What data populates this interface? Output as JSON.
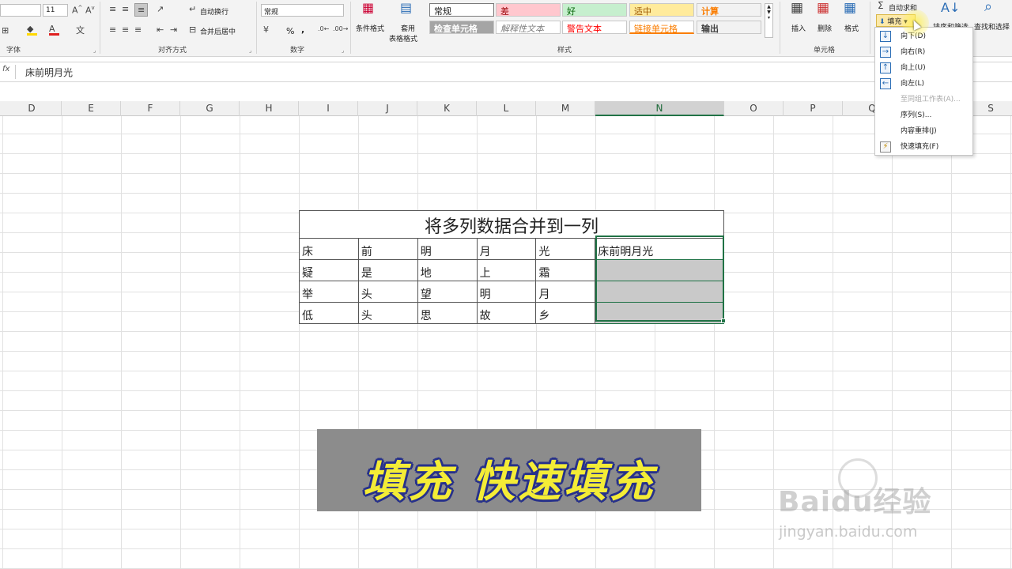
{
  "ribbon": {
    "font_size": "11",
    "groups": {
      "font": "字体",
      "align": "对齐方式",
      "number": "数字",
      "styles": "样式",
      "cells": "单元格"
    },
    "align": {
      "wrap": "自动换行",
      "merge": "合并后居中"
    },
    "number_format": "常规",
    "number_symbols": {
      "percent": "%",
      "comma": ","
    },
    "buttons": {
      "conditional_format": "条件格式",
      "table_format_1": "套用",
      "table_format_2": "表格格式",
      "insert": "插入",
      "delete": "删除",
      "format": "格式",
      "autosum": "自动求和",
      "fill": "填充",
      "sort_filter": "排序和筛选",
      "find_select": "查找和选择"
    },
    "cell_styles": [
      {
        "label": "常规",
        "bg": "#ffffff",
        "color": "#222222",
        "style": "normal"
      },
      {
        "label": "差",
        "bg": "#ffc7ce",
        "color": "#9c0006",
        "style": "normal"
      },
      {
        "label": "好",
        "bg": "#c6efce",
        "color": "#006100",
        "style": "normal"
      },
      {
        "label": "适中",
        "bg": "#ffeb9c",
        "color": "#9c5700",
        "style": "normal"
      },
      {
        "label": "计算",
        "bg": "#f2f2f2",
        "color": "#fa7d00",
        "style": "bold"
      },
      {
        "label": "检查单元格",
        "bg": "#a5a5a5",
        "color": "#ffffff",
        "style": "bold"
      },
      {
        "label": "解释性文本",
        "bg": "#ffffff",
        "color": "#7f7f7f",
        "style": "italic"
      },
      {
        "label": "警告文本",
        "bg": "#ffffff",
        "color": "#ff0000",
        "style": "normal"
      },
      {
        "label": "链接单元格",
        "bg": "#ffffff",
        "color": "#fa7d00",
        "style": "underline"
      },
      {
        "label": "输出",
        "bg": "#f2f2f2",
        "color": "#3f3f3f",
        "style": "bold"
      }
    ]
  },
  "fill_menu": {
    "items": [
      {
        "label": "向下(D)",
        "icon": "arrow-down-icon",
        "glyph": "↓",
        "disabled": false
      },
      {
        "label": "向右(R)",
        "icon": "arrow-right-icon",
        "glyph": "→",
        "disabled": false
      },
      {
        "label": "向上(U)",
        "icon": "arrow-up-icon",
        "glyph": "↑",
        "disabled": false
      },
      {
        "label": "向左(L)",
        "icon": "arrow-left-icon",
        "glyph": "←",
        "disabled": false
      },
      {
        "label": "至同组工作表(A)...",
        "icon": "",
        "glyph": "",
        "disabled": true
      },
      {
        "label": "序列(S)...",
        "icon": "",
        "glyph": "",
        "disabled": false
      },
      {
        "label": "内容重排(J)",
        "icon": "",
        "glyph": "",
        "disabled": false
      },
      {
        "label": "快速填充(F)",
        "icon": "flash-fill-icon",
        "glyph": "⚡",
        "disabled": false
      }
    ]
  },
  "formula_bar": {
    "fx": "fx",
    "value": "床前明月光"
  },
  "columns": [
    "D",
    "E",
    "F",
    "G",
    "H",
    "I",
    "J",
    "K",
    "L",
    "M",
    "N",
    "O",
    "P",
    "Q",
    "R",
    "S"
  ],
  "selected_column": "N",
  "table": {
    "title": "将多列数据合并到一列",
    "rows": [
      [
        "床",
        "前",
        "明",
        "月",
        "光",
        "床前明月光"
      ],
      [
        "疑",
        "是",
        "地",
        "上",
        "霜",
        ""
      ],
      [
        "举",
        "头",
        "望",
        "明",
        "月",
        ""
      ],
      [
        "低",
        "头",
        "思",
        "故",
        "乡",
        ""
      ]
    ]
  },
  "banner": {
    "text": "填充 快速填充"
  },
  "watermark": {
    "logo": "Baidu经验",
    "url": "jingyan.baidu.com"
  }
}
